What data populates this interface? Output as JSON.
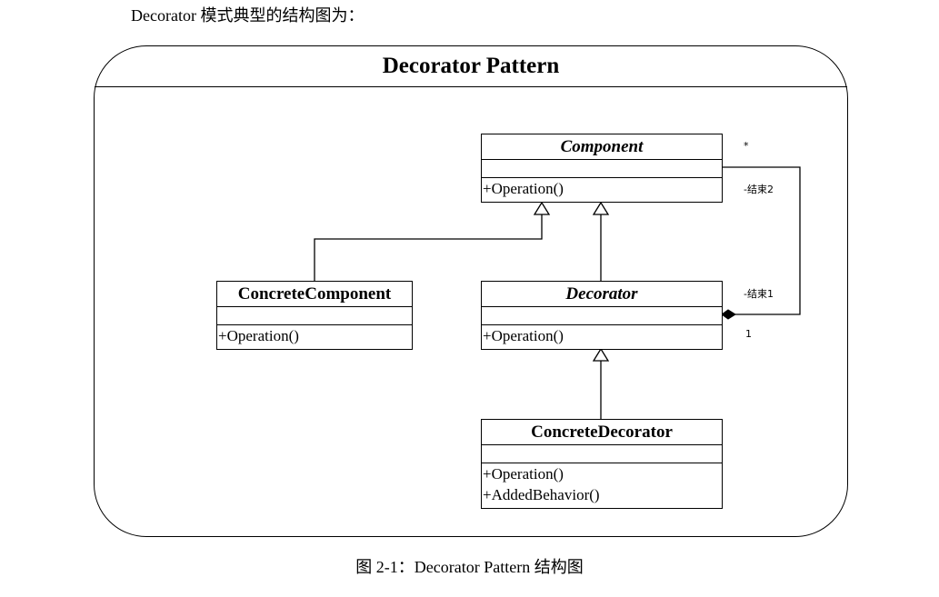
{
  "intro": "Decorator 模式典型的结构图为：",
  "diagram": {
    "title": "Decorator Pattern",
    "classes": {
      "component": {
        "name": "Component",
        "ops": [
          "+Operation()"
        ]
      },
      "concrete_component": {
        "name": "ConcreteComponent",
        "ops": [
          "+Operation()"
        ]
      },
      "decorator": {
        "name": "Decorator",
        "ops": [
          "+Operation()"
        ]
      },
      "concrete_decorator": {
        "name": "ConcreteDecorator",
        "ops": [
          "+Operation()",
          "+AddedBehavior()"
        ]
      }
    },
    "association": {
      "end2_multiplicity": "*",
      "end2_label": "-结束2",
      "end1_label": "-结束1",
      "end1_multiplicity": "1"
    }
  },
  "caption": "图 2-1：Decorator Pattern 结构图"
}
